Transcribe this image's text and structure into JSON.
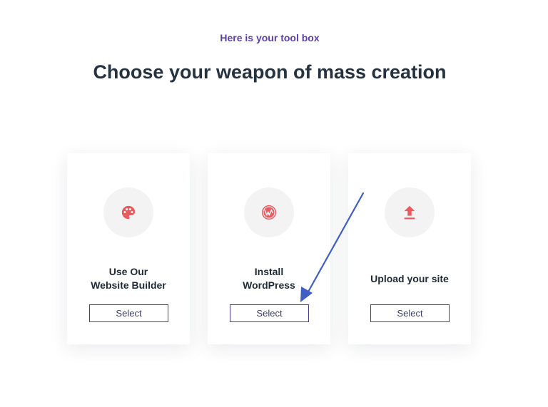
{
  "header": {
    "kicker": "Here is your tool box",
    "title": "Choose your weapon of mass creation"
  },
  "cards": [
    {
      "icon": "palette-icon",
      "label": "Use Our\nWebsite Builder",
      "button": "Select"
    },
    {
      "icon": "wordpress-icon",
      "label": "Install\nWordPress",
      "button": "Select"
    },
    {
      "icon": "upload-icon",
      "label": "Upload your site",
      "button": "Select"
    }
  ],
  "colors": {
    "accent": "#5b3fa6",
    "icon": "#ea5a5e",
    "annotation_arrow": "#3f5fc4"
  }
}
